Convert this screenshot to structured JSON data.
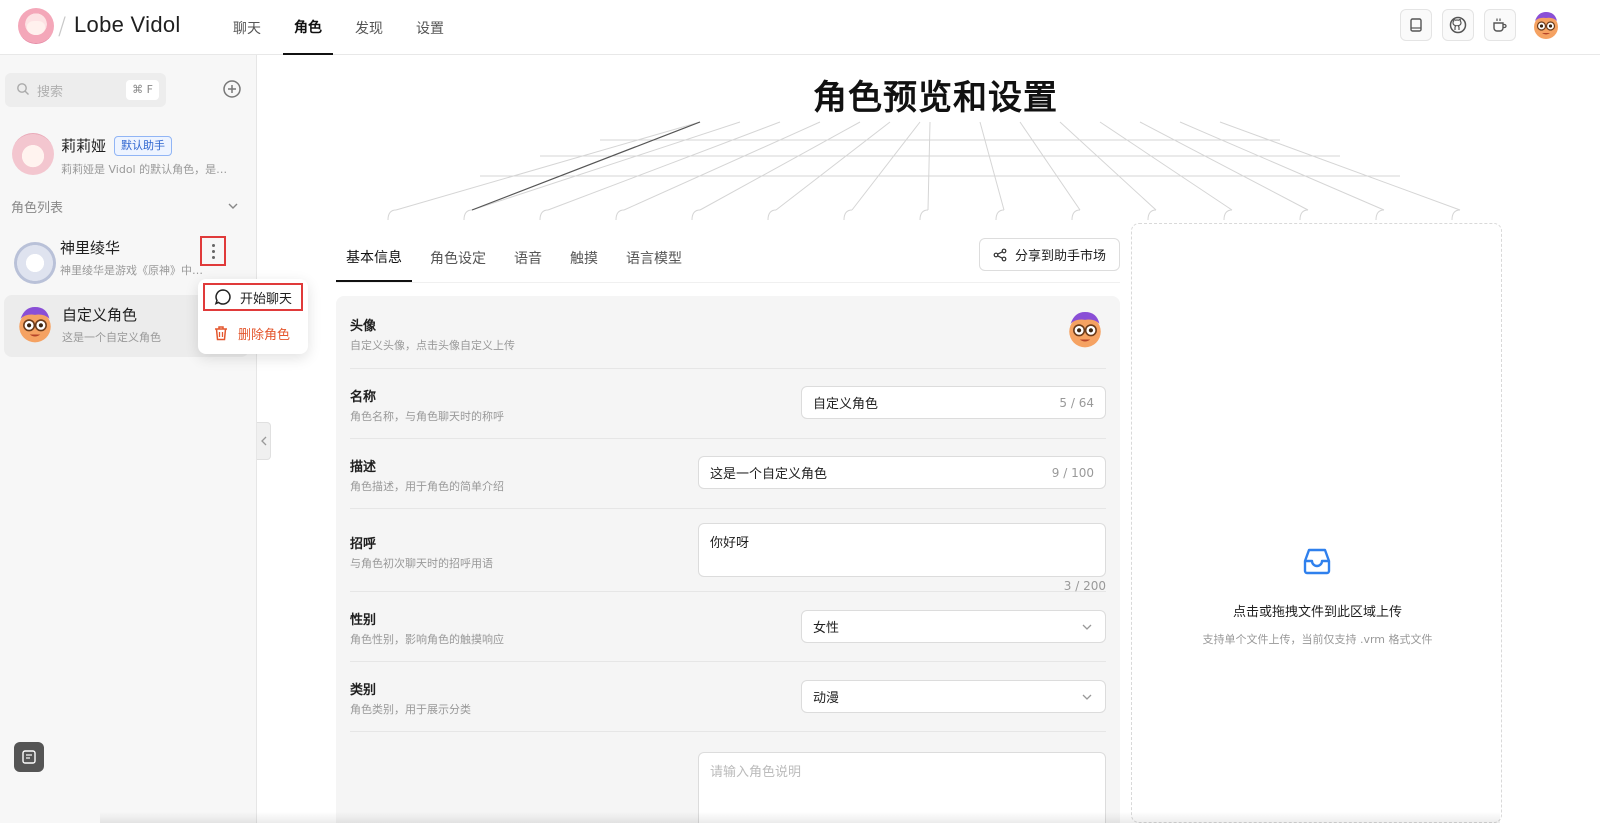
{
  "app": {
    "name": "Lobe Vidol"
  },
  "nav": [
    {
      "label": "聊天"
    },
    {
      "label": "角色"
    },
    {
      "label": "发现"
    },
    {
      "label": "设置"
    }
  ],
  "header_actions": [
    "book-icon",
    "github-icon",
    "coffee-icon"
  ],
  "sidebar": {
    "search_placeholder": "搜索",
    "shortcut": "⌘ F",
    "default_role": {
      "name": "莉莉娅",
      "tag": "默认助手",
      "desc": "莉莉娅是 Vidol 的默认角色，是…"
    },
    "section_label": "角色列表",
    "roles": [
      {
        "name": "神里绫华",
        "desc": "神里绫华是游戏《原神》中的角色"
      },
      {
        "name": "自定义角色",
        "desc": "这是一个自定义角色"
      }
    ],
    "menu": {
      "start_chat": "开始聊天",
      "delete_role": "删除角色"
    }
  },
  "main": {
    "title": "角色预览和设置",
    "tabs": [
      "基本信息",
      "角色设定",
      "语音",
      "触摸",
      "语言模型"
    ],
    "share_label": "分享到助手市场",
    "form": {
      "avatar": {
        "title": "头像",
        "desc": "自定义头像，点击头像自定义上传"
      },
      "name": {
        "title": "名称",
        "desc": "角色名称，与角色聊天时的称呼",
        "value": "自定义角色",
        "count": "5 / 64"
      },
      "description": {
        "title": "描述",
        "desc": "角色描述，用于角色的简单介绍",
        "value": "这是一个自定义角色",
        "count": "9 / 100"
      },
      "greeting": {
        "title": "招呼",
        "desc": "与角色初次聊天时的招呼用语",
        "value": "你好呀",
        "count": "3 / 200"
      },
      "gender": {
        "title": "性别",
        "desc": "角色性别，影响角色的触摸响应",
        "value": "女性"
      },
      "category": {
        "title": "类别",
        "desc": "角色类别，用于展示分类",
        "value": "动漫"
      },
      "readme": {
        "placeholder": "请输入角色说明"
      }
    },
    "upload": {
      "title": "点击或拖拽文件到此区域上传",
      "hint": "支持单个文件上传，当前仅支持 .vrm 格式文件"
    }
  },
  "colors": {
    "highlight": "#e03a3a",
    "danger": "#e4572e",
    "tag_blue": "#2f66d0",
    "upload_blue": "#2f80ed"
  }
}
